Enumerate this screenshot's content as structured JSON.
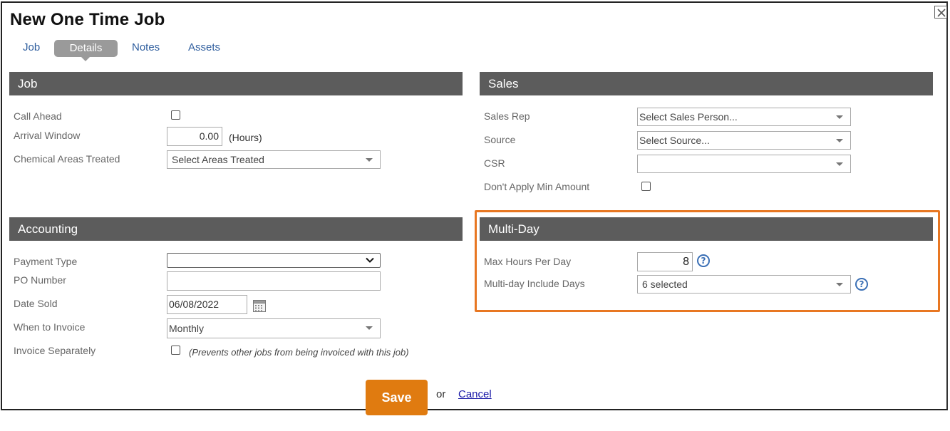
{
  "title": "New One Time Job",
  "tabs": [
    {
      "label": "Job"
    },
    {
      "label": "Details"
    },
    {
      "label": "Notes"
    },
    {
      "label": "Assets"
    }
  ],
  "active_tab": "Details",
  "job": {
    "header": "Job",
    "call_ahead_label": "Call Ahead",
    "call_ahead_checked": false,
    "arrival_window_label": "Arrival Window",
    "arrival_window_value": "0.00",
    "arrival_window_unit": "(Hours)",
    "chemical_areas_label": "Chemical Areas Treated",
    "chemical_areas_value": "Select Areas Treated"
  },
  "sales": {
    "header": "Sales",
    "sales_rep_label": "Sales Rep",
    "sales_rep_value": "Select Sales Person...",
    "source_label": "Source",
    "source_value": "Select Source...",
    "csr_label": "CSR",
    "csr_value": "",
    "min_amount_label": "Don't Apply Min Amount",
    "min_amount_checked": false
  },
  "accounting": {
    "header": "Accounting",
    "payment_type_label": "Payment Type",
    "payment_type_value": "",
    "po_number_label": "PO Number",
    "po_number_value": "",
    "date_sold_label": "Date Sold",
    "date_sold_value": "06/08/2022",
    "when_to_invoice_label": "When to Invoice",
    "when_to_invoice_value": "Monthly",
    "invoice_separately_label": "Invoice Separately",
    "invoice_separately_checked": false,
    "invoice_separately_note": "(Prevents other jobs from being invoiced with this job)"
  },
  "multiday": {
    "header": "Multi-Day",
    "max_hours_label": "Max Hours Per Day",
    "max_hours_value": "8",
    "include_days_label": "Multi-day Include Days",
    "include_days_value": "6 selected",
    "help_glyph": "?"
  },
  "actions": {
    "save_label": "Save",
    "or_text": "or",
    "cancel_label": "Cancel"
  },
  "colors": {
    "section_header": "#5c5c5c",
    "save_button": "#e07b10",
    "highlight_border": "#e87722",
    "link": "#2f5e9e"
  },
  "icons": [
    "close-icon",
    "calendar-icon",
    "help-icon",
    "chevron-down-icon"
  ]
}
